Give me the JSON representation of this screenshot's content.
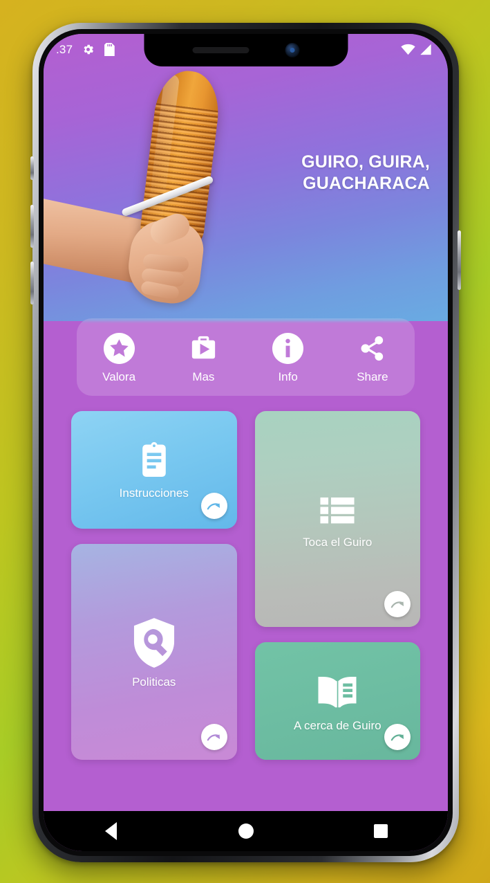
{
  "statusbar": {
    "time": ".37",
    "icons_left": [
      "gear-icon",
      "sdcard-icon"
    ],
    "icons_right": [
      "wifi-icon",
      "signal-icon"
    ]
  },
  "hero": {
    "title": "GUIRO, GUIRA, GUACHARACA",
    "image_alt": "hand-playing-guiro"
  },
  "actions": [
    {
      "label": "Valora",
      "icon": "star-circle-icon"
    },
    {
      "label": "Mas",
      "icon": "briefcase-play-icon"
    },
    {
      "label": "Info",
      "icon": "info-circle-icon"
    },
    {
      "label": "Share",
      "icon": "share-icon"
    }
  ],
  "cards": {
    "instrucciones": {
      "label": "Instrucciones",
      "icon": "clipboard-icon",
      "go_icon": "curved-arrow-icon",
      "color": "#79c8f0"
    },
    "politicas": {
      "label": "Politicas",
      "icon": "shield-search-icon",
      "go_icon": "curved-arrow-icon",
      "color": "#b39adc"
    },
    "toca": {
      "label": "Toca el Guiro",
      "icon": "list-icon",
      "go_icon": "curved-arrow-icon",
      "color": "#aecfc0"
    },
    "acerca": {
      "label": "A cerca de Guiro",
      "icon": "open-book-icon",
      "go_icon": "curved-arrow-icon",
      "color": "#6dbda2"
    }
  },
  "navbar": {
    "back": "back-triangle-icon",
    "home": "home-circle-icon",
    "recents": "recents-square-icon"
  }
}
